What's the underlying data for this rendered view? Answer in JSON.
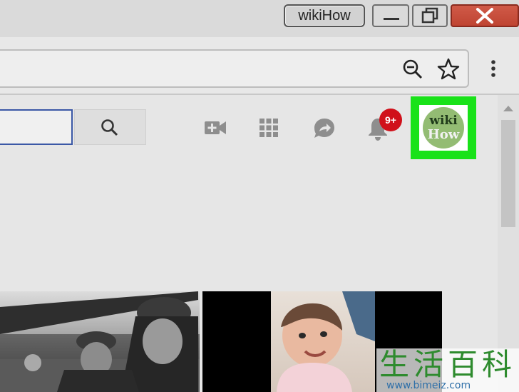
{
  "window": {
    "profile_name": "wikiHow",
    "icons": {
      "minimize": "minimize-icon",
      "maximize": "restore-icon",
      "close": "close-icon"
    },
    "colors": {
      "close": "#c44a38"
    }
  },
  "browser": {
    "icons": {
      "zoom": "zoom-out-icon",
      "bookmark": "star-icon",
      "menu": "kebab-menu-icon"
    }
  },
  "header": {
    "search": {
      "value": "",
      "placeholder": ""
    },
    "icons": {
      "search": "search-icon",
      "create": "video-camera-plus-icon",
      "apps": "apps-grid-icon",
      "messages": "share-message-icon",
      "notifications": "bell-icon"
    },
    "notification_badge": "9+",
    "account": {
      "avatar_line1": "wiki",
      "avatar_line2": "How",
      "highlight_color": "#19e219"
    }
  },
  "watermark": {
    "text": "生活百科",
    "url": "www.bimeiz.com"
  }
}
